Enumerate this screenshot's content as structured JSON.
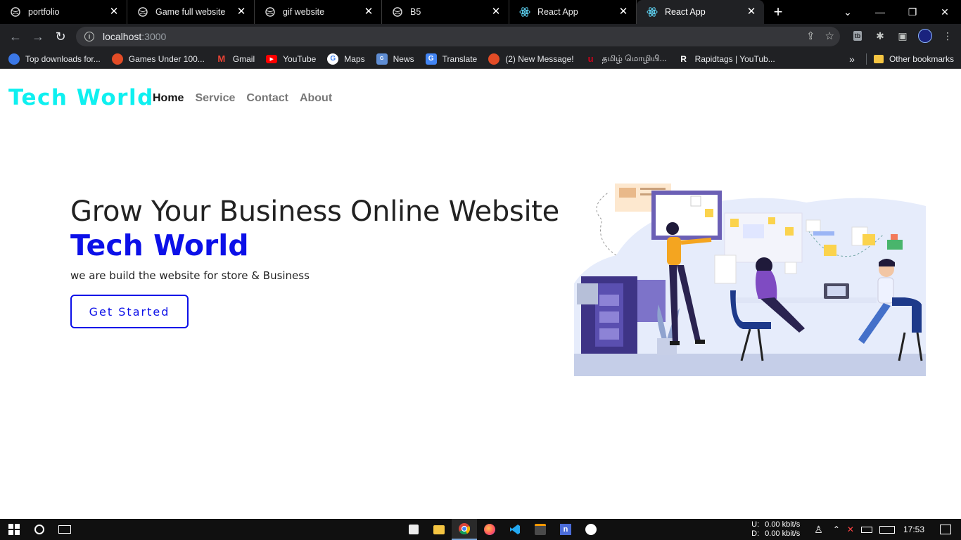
{
  "browser": {
    "tabs": [
      {
        "title": "portfolio",
        "icon": "globe-icon"
      },
      {
        "title": "Game full website",
        "icon": "globe-icon"
      },
      {
        "title": "gif website",
        "icon": "globe-icon"
      },
      {
        "title": "B5",
        "icon": "globe-icon"
      },
      {
        "title": "React App",
        "icon": "react-icon"
      },
      {
        "title": "React App",
        "icon": "react-icon",
        "active": true
      }
    ],
    "url_host": "localhost",
    "url_port": ":3000",
    "bookmarks": [
      {
        "label": "Top downloads for...",
        "color": "#3b78e7"
      },
      {
        "label": "Games Under 100...",
        "color": "#e34c26"
      },
      {
        "label": "Gmail",
        "color": "#ea4335"
      },
      {
        "label": "YouTube",
        "color": "#ff0000"
      },
      {
        "label": "Maps",
        "color": "#4285f4"
      },
      {
        "label": "News",
        "color": "#5f8dd3"
      },
      {
        "label": "Translate",
        "color": "#4285f4"
      },
      {
        "label": "(2) New Message!",
        "color": "#e34c26"
      },
      {
        "label": "தமிழ் மொழியி...",
        "color": "#d0021b"
      },
      {
        "label": "Rapidtags | YouTub...",
        "color": "#111111"
      }
    ],
    "bookmarks_overflow": "»",
    "other_bookmarks": "Other bookmarks"
  },
  "site": {
    "brand": "Tech World",
    "nav": [
      "Home",
      "Service",
      "Contact",
      "About"
    ],
    "hero_title": "Grow Your Business Online Website",
    "hero_brand": "Tech World",
    "hero_sub": "we are build the website for store & Business",
    "cta": "Get Started",
    "colors": {
      "brand": "#0ff0f0",
      "accent": "#0c10e8"
    }
  },
  "taskbar": {
    "net_u_label": "U:",
    "net_d_label": "D:",
    "net_up": "0.00 kbit/s",
    "net_down": "0.00 kbit/s",
    "time": "17:53"
  }
}
